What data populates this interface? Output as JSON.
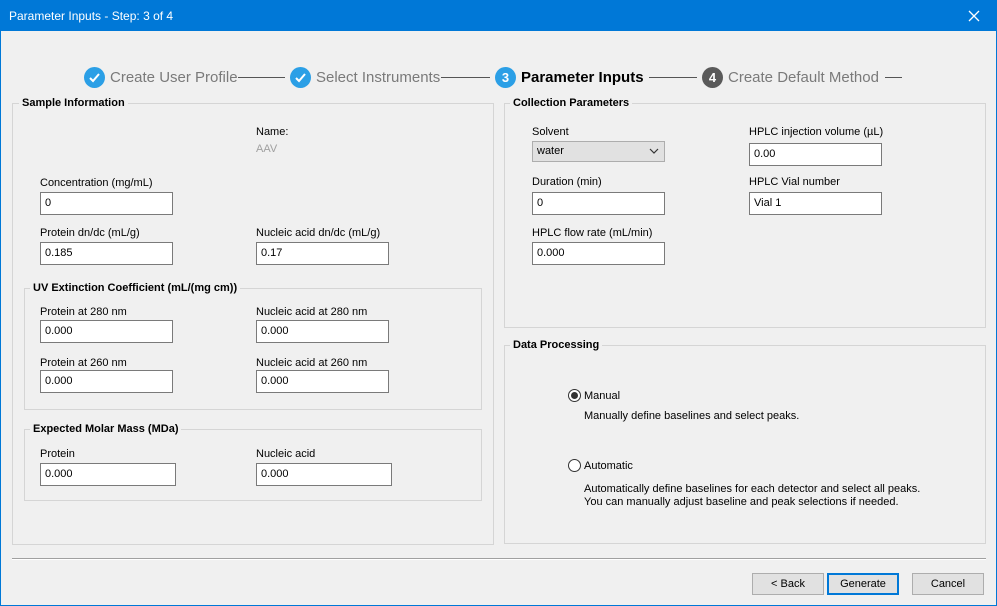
{
  "window": {
    "title": "Parameter Inputs - Step: 3 of 4"
  },
  "stepper": {
    "steps": [
      {
        "number": "✓",
        "label": "Create User Profile",
        "state": "done"
      },
      {
        "number": "✓",
        "label": "Select Instruments",
        "state": "done"
      },
      {
        "number": "3",
        "label": "Parameter Inputs",
        "state": "current"
      },
      {
        "number": "4",
        "label": "Create Default Method",
        "state": "future"
      }
    ]
  },
  "sample_information": {
    "title": "Sample Information",
    "name_label": "Name:",
    "name_value": "AAV",
    "concentration_label": "Concentration (mg/mL)",
    "concentration_value": "0",
    "protein_dndc_label": "Protein dn/dc (mL/g)",
    "protein_dndc_value": "0.185",
    "nucleic_dndc_label": "Nucleic acid dn/dc (mL/g)",
    "nucleic_dndc_value": "0.17",
    "uv": {
      "title": "UV Extinction Coefficient (mL/(mg cm))",
      "protein_280_label": "Protein at 280 nm",
      "protein_280_value": "0.000",
      "nucleic_280_label": "Nucleic acid at 280 nm",
      "nucleic_280_value": "0.000",
      "protein_260_label": "Protein at 260 nm",
      "protein_260_value": "0.000",
      "nucleic_260_label": "Nucleic acid at 260 nm",
      "nucleic_260_value": "0.000"
    },
    "molar_mass": {
      "title": "Expected Molar Mass (MDa)",
      "protein_label": "Protein",
      "protein_value": "0.000",
      "nucleic_label": "Nucleic acid",
      "nucleic_value": "0.000"
    }
  },
  "collection_parameters": {
    "title": "Collection Parameters",
    "solvent_label": "Solvent",
    "solvent_value": "water",
    "duration_label": "Duration (min)",
    "duration_value": "0",
    "flow_rate_label": "HPLC flow rate (mL/min)",
    "flow_rate_value": "0.000",
    "injection_volume_label": "HPLC injection volume (µL)",
    "injection_volume_value": "0.00",
    "vial_label": "HPLC Vial number",
    "vial_value": "Vial 1"
  },
  "data_processing": {
    "title": "Data Processing",
    "manual_label": "Manual",
    "manual_desc": "Manually define baselines and select peaks.",
    "automatic_label": "Automatic",
    "automatic_desc_1": "Automatically define baselines for each detector and select all peaks.",
    "automatic_desc_2": "You can manually adjust baseline and peak selections if needed.",
    "selected": "manual"
  },
  "footer": {
    "back_label": "< Back",
    "generate_label": "Generate",
    "cancel_label": "Cancel"
  },
  "colors": {
    "titlebar": "#0078d7",
    "step_active": "#2b9fe6",
    "step_future": "#5a5a5a"
  }
}
